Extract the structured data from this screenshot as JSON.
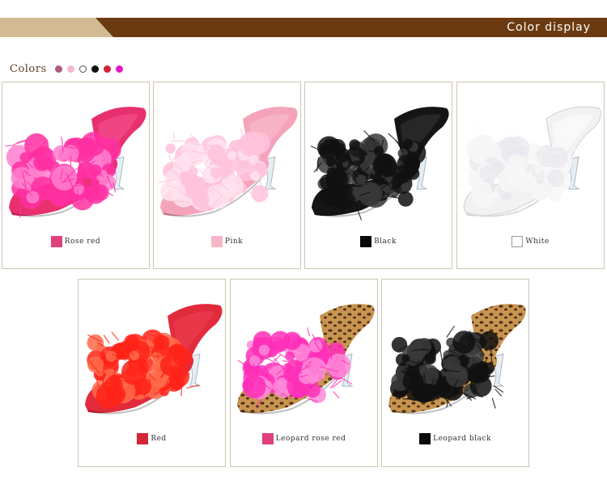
{
  "header": {
    "title": "Color display"
  },
  "colors_label": "Colors",
  "color_dots": [
    {
      "color": "#b05a82",
      "name": "dot-mauve"
    },
    {
      "color": "#f5b8cc",
      "name": "dot-pink"
    },
    {
      "color": "#ffffff",
      "name": "dot-white"
    },
    {
      "color": "#111111",
      "name": "dot-black"
    },
    {
      "color": "#d41f3a",
      "name": "dot-red"
    },
    {
      "color": "#e817c9",
      "name": "dot-magenta"
    }
  ],
  "products": [
    {
      "label": "Rose red",
      "swatch": "#e0407c",
      "fur": "#ff2fa2",
      "fur2": "#ff7fcf",
      "shoe": "#e8306f",
      "insole": "#f04a87",
      "heel": "clear",
      "leopard": false
    },
    {
      "label": "Pink",
      "swatch": "#f6b6c8",
      "fur": "#ffc3dc",
      "fur2": "#ffe3ef",
      "shoe": "#f5a3bb",
      "insole": "#f8b7c9",
      "heel": "clear",
      "leopard": false
    },
    {
      "label": "Black",
      "swatch": "#0a0a0a",
      "fur": "#111111",
      "fur2": "#3a3a3a",
      "shoe": "#151515",
      "insole": "#2a2a2a",
      "heel": "clear",
      "leopard": false
    },
    {
      "label": "White",
      "swatch": "#ffffff",
      "fur": "#f7f7f7",
      "fur2": "#e9e9ee",
      "shoe": "#f2f2f2",
      "insole": "#fafafa",
      "heel": "clear",
      "leopard": false
    },
    {
      "label": "Red",
      "swatch": "#d42638",
      "fur": "#ff2318",
      "fur2": "#ff6a4a",
      "shoe": "#e22a3d",
      "insole": "#ea3a4c",
      "heel": "clear",
      "leopard": false
    },
    {
      "label": "Leopard rose red",
      "swatch": "#e0407c",
      "fur": "#ff2fb8",
      "fur2": "#ff8ad8",
      "shoe": "#8a5a2a",
      "insole": "#c89456",
      "heel": "clear",
      "leopard": true
    },
    {
      "label": "Leopard black",
      "swatch": "#0a0a0a",
      "fur": "#111111",
      "fur2": "#3a3a3a",
      "shoe": "#8a5a2a",
      "insole": "#c89456",
      "heel": "clear",
      "leopard": true
    }
  ],
  "colors": {
    "banner_dark": "#6b3a10",
    "banner_light": "#d1ba94"
  }
}
